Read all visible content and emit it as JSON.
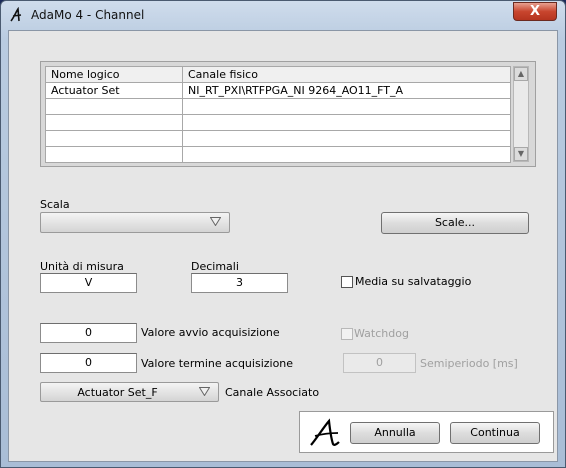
{
  "window": {
    "title": "AdaMo 4 - Channel",
    "close_glyph": "X"
  },
  "channels_table": {
    "headers": [
      "Nome logico",
      "Canale fisico"
    ],
    "rows": [
      [
        "Actuator Set",
        "NI_RT_PXI\\RTFPGA_NI 9264_AO11_FT_A"
      ],
      [
        "",
        ""
      ],
      [
        "",
        ""
      ],
      [
        "",
        ""
      ],
      [
        "",
        ""
      ]
    ]
  },
  "scala": {
    "label": "Scala",
    "value": "",
    "button": "Scale..."
  },
  "unita": {
    "label": "Unità di misura",
    "value": "V"
  },
  "decimali": {
    "label": "Decimali",
    "value": "3"
  },
  "media": {
    "label": "Media su salvataggio",
    "checked": false
  },
  "avvio": {
    "value": "0",
    "label": "Valore avvio acquisizione"
  },
  "termine": {
    "value": "0",
    "label": "Valore termine acquisizione"
  },
  "watchdog": {
    "label": "Watchdog",
    "checked": false,
    "enabled": false
  },
  "semiperiodo": {
    "value": "0",
    "label": "Semiperiodo [ms]"
  },
  "canale_associato": {
    "value": "Actuator Set_F",
    "label": "Canale Associato"
  },
  "footer": {
    "cancel": "Annulla",
    "continue": "Continua"
  }
}
